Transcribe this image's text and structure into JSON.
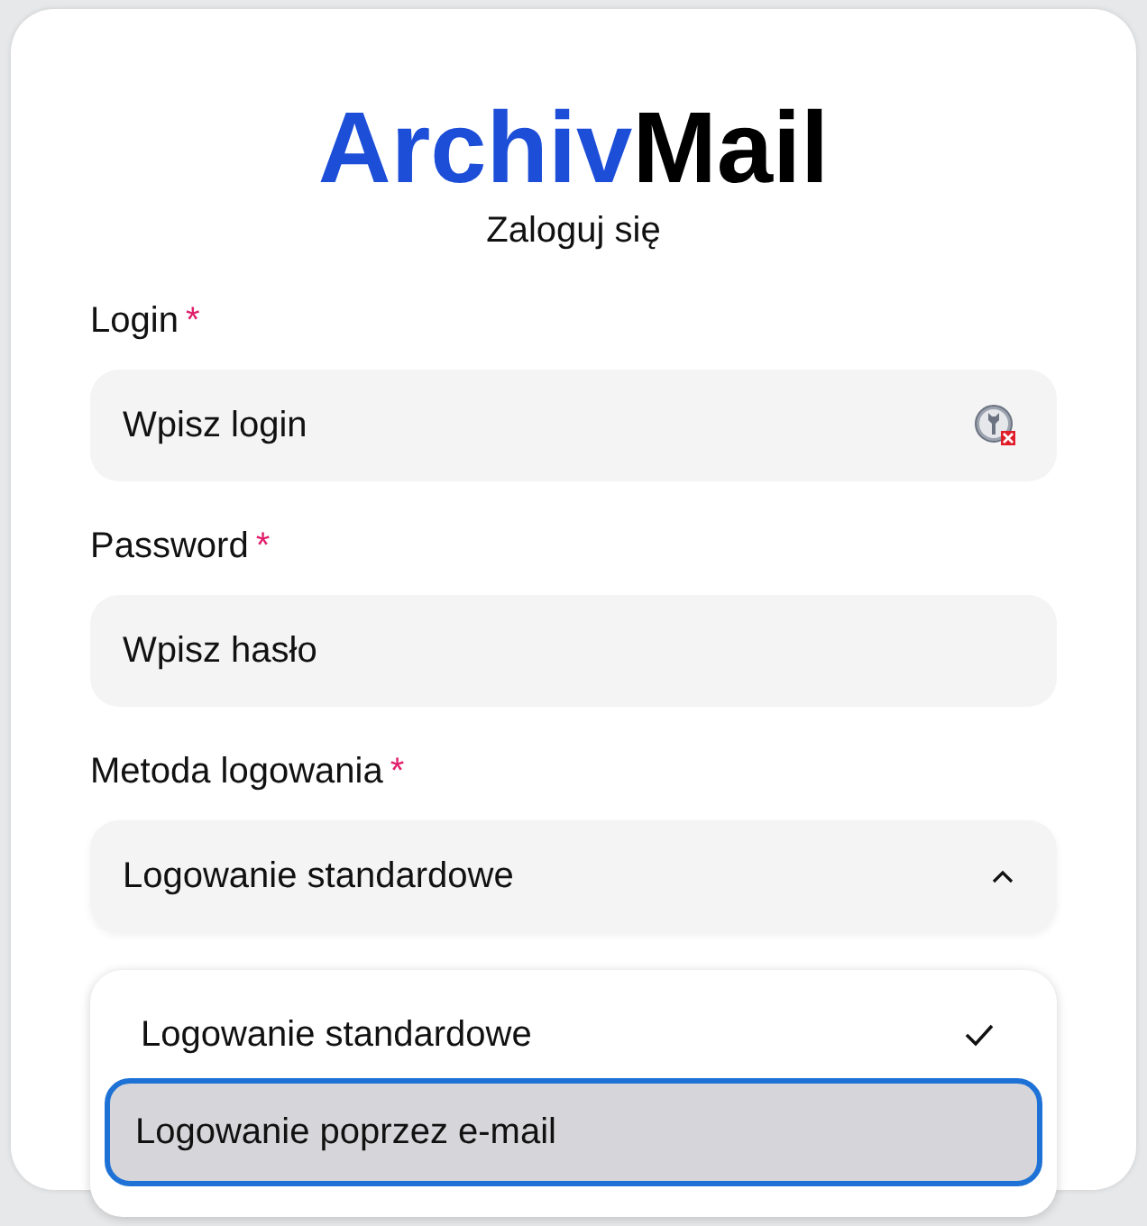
{
  "logo": {
    "first": "Archiv",
    "second": "Mail"
  },
  "subtitle": "Zaloguj się",
  "fields": [
    {
      "label": "Login",
      "required_mark": "*",
      "placeholder": "Wpisz login",
      "kind": "text",
      "password_manager_icon": true
    },
    {
      "label": "Password",
      "required_mark": "*",
      "placeholder": "Wpisz hasło",
      "kind": "text"
    },
    {
      "label": "Metoda logowania",
      "required_mark": "*",
      "value": "Logowanie standardowe",
      "kind": "select",
      "expanded": true
    }
  ],
  "dropdown": {
    "options": [
      {
        "label": "Logowanie standardowe",
        "selected": true,
        "focused": false
      },
      {
        "label": "Logowanie poprzez e-mail",
        "selected": false,
        "focused": true
      }
    ]
  }
}
